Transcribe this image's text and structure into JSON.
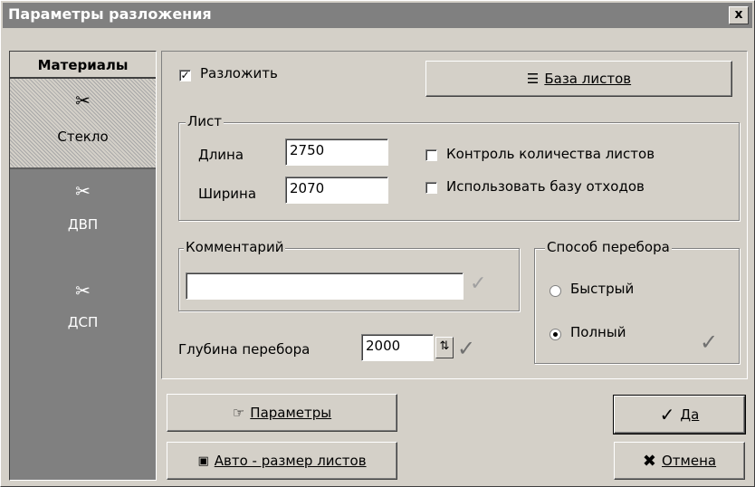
{
  "window": {
    "title": "Параметры разложения",
    "close_label": "x"
  },
  "materials": {
    "header": "Материалы",
    "items": [
      {
        "label": "Стекло",
        "icon": "scissors-icon"
      },
      {
        "label": "ДВП",
        "icon": "scissors-icon"
      },
      {
        "label": "ДСП",
        "icon": "scissors-icon"
      }
    ]
  },
  "layout_checkbox": {
    "label": "Разложить",
    "checked": true
  },
  "sheet_base_button": {
    "label": "База листов"
  },
  "sheet_group": {
    "label": "Лист",
    "length_label": "Длина",
    "length_value": "2750",
    "width_label": "Ширина",
    "width_value": "2070",
    "control_label": "Контроль количества листов",
    "waste_label": "Использовать базу отходов"
  },
  "comment_group": {
    "label": "Комментарий",
    "value": ""
  },
  "search_group": {
    "label": "Способ перебора",
    "fast_label": "Быстрый",
    "full_label": "Полный",
    "selected": "Полный"
  },
  "depth": {
    "label": "Глубина перебора",
    "value": "2000"
  },
  "buttons": {
    "params": "Параметры",
    "auto_size": "Авто - размер листов",
    "ok": "Да",
    "cancel": "Отмена"
  }
}
